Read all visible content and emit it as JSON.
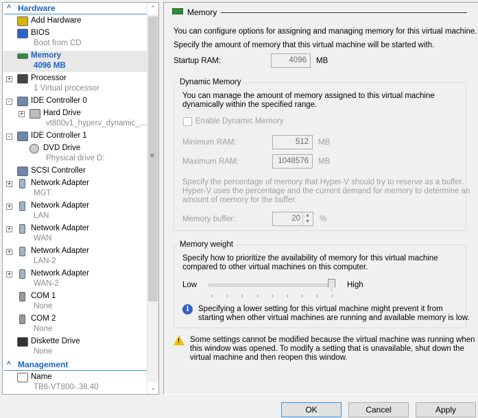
{
  "tree": {
    "hardware_label": "Hardware",
    "management_label": "Management",
    "items": [
      {
        "label": "Add Hardware",
        "sub": "",
        "icon": "add-hardware-icon"
      },
      {
        "label": "BIOS",
        "sub": "Boot from CD",
        "icon": "bios-icon"
      },
      {
        "label": "Memory",
        "sub": "4096 MB",
        "icon": "memory-icon",
        "selected": true
      },
      {
        "label": "Processor",
        "sub": "1 Virtual processor",
        "icon": "processor-icon",
        "expander": "+"
      },
      {
        "label": "IDE Controller 0",
        "sub": "",
        "icon": "ide-controller-icon",
        "expander": "-"
      },
      {
        "label": "Hard Drive",
        "sub": "vt800v1_hyperv_dynamic_...",
        "icon": "hard-drive-icon",
        "expander": "+",
        "indent": 1
      },
      {
        "label": "IDE Controller 1",
        "sub": "",
        "icon": "ide-controller-icon",
        "expander": "-"
      },
      {
        "label": "DVD Drive",
        "sub": "Physical drive D:",
        "icon": "dvd-drive-icon",
        "indent": 1
      },
      {
        "label": "SCSI Controller",
        "sub": "",
        "icon": "scsi-controller-icon"
      },
      {
        "label": "Network Adapter",
        "sub": "MGT",
        "icon": "network-adapter-icon",
        "expander": "+"
      },
      {
        "label": "Network Adapter",
        "sub": "LAN",
        "icon": "network-adapter-icon",
        "expander": "+"
      },
      {
        "label": "Network Adapter",
        "sub": "WAN",
        "icon": "network-adapter-icon",
        "expander": "+"
      },
      {
        "label": "Network Adapter",
        "sub": "LAN-2",
        "icon": "network-adapter-icon",
        "expander": "+"
      },
      {
        "label": "Network Adapter",
        "sub": "WAN-2",
        "icon": "network-adapter-icon",
        "expander": "+"
      },
      {
        "label": "COM 1",
        "sub": "None",
        "icon": "com-port-icon"
      },
      {
        "label": "COM 2",
        "sub": "None",
        "icon": "com-port-icon"
      },
      {
        "label": "Diskette Drive",
        "sub": "None",
        "icon": "diskette-drive-icon"
      }
    ],
    "management_items": [
      {
        "label": "Name",
        "sub": "TB6-VT800-.38.40",
        "icon": "name-icon"
      }
    ]
  },
  "memory": {
    "title": "Memory",
    "intro": "You can configure options for assigning and managing memory for this virtual machine.",
    "startup_desc": "Specify the amount of memory that this virtual machine will be started with.",
    "startup_label": "Startup RAM:",
    "startup_value": "4096",
    "unit_mb": "MB",
    "dynamic": {
      "title": "Dynamic Memory",
      "desc1": "You can manage the amount of memory assigned to this virtual machine",
      "desc2": "dynamically within the specified range.",
      "enable_label": "Enable Dynamic Memory",
      "enabled": false,
      "min_label": "Minimum RAM:",
      "min_value": "512",
      "max_label": "Maximum RAM:",
      "max_value": "1048576",
      "buffer_desc1": "Specify the percentage of memory that Hyper-V should try to reserve as a buffer.",
      "buffer_desc2": "Hyper-V uses the percentage and the current demand for memory to determine an",
      "buffer_desc3": "amount of memory for the buffer.",
      "buffer_label": "Memory buffer:",
      "buffer_value": "20",
      "buffer_unit": "%"
    },
    "weight": {
      "title": "Memory weight",
      "desc1": "Specify how to prioritize the availability of memory for this virtual machine",
      "desc2": "compared to other virtual machines on this computer.",
      "low_label": "Low",
      "high_label": "High",
      "value_fraction": 1.0,
      "info1": "Specifying a lower setting for this virtual machine might prevent it from",
      "info2": "starting when other virtual machines are running and available memory is low."
    },
    "warning1": "Some settings cannot be modified because the virtual machine was running when",
    "warning2": "this window was opened. To modify a setting that is unavailable, shut down the",
    "warning3": "virtual machine and then reopen this window."
  },
  "buttons": {
    "ok": "OK",
    "cancel": "Cancel",
    "apply": "Apply"
  }
}
